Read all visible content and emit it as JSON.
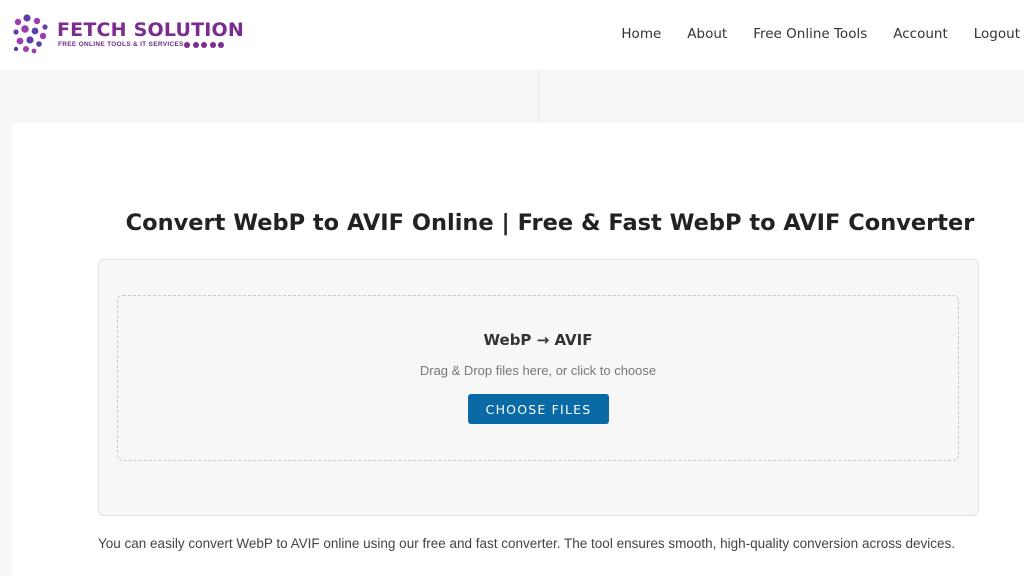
{
  "logo": {
    "name": "FETCH SOLUTION",
    "tagline": "FREE ONLINE TOOLS & IT SERVICES"
  },
  "nav": {
    "items": [
      {
        "label": "Home"
      },
      {
        "label": "About"
      },
      {
        "label": "Free Online Tools"
      },
      {
        "label": "Account"
      },
      {
        "label": "Logout"
      }
    ]
  },
  "main": {
    "title": "Convert WebP to AVIF Online | Free & Fast WebP to AVIF Converter",
    "converter": {
      "heading": "WebP → AVIF",
      "hint": "Drag & Drop files here, or click to choose",
      "button_label": "CHOOSE FILES"
    },
    "description": "You can easily convert WebP to AVIF online using our free and fast converter. The tool ensures smooth, high-quality conversion across devices."
  },
  "colors": {
    "brand": "#7a2c8f",
    "button": "#0a6aa6"
  }
}
